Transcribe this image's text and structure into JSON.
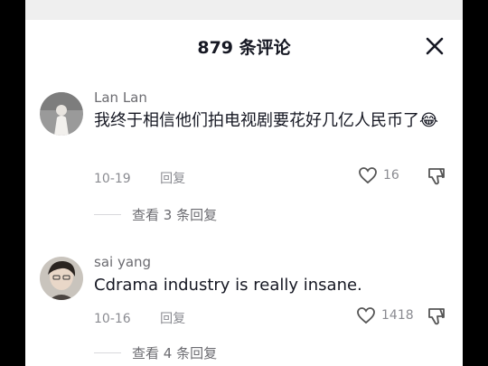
{
  "header": {
    "count": "879",
    "title_suffix": "条评论"
  },
  "comments": [
    {
      "username": "Lan Lan",
      "text": "我终于相信他们拍电视剧要花好几亿人民币了",
      "emoji": "😂",
      "date": "10-19",
      "reply_label": "回复",
      "likes": "16",
      "view_replies": "查看 3 条回复"
    },
    {
      "username": "sai yang",
      "text": "Cdrama industry is really insane.",
      "date": "10-16",
      "reply_label": "回复",
      "likes": "1418",
      "view_replies": "查看 4 条回复"
    }
  ],
  "icons": [
    "close-icon",
    "heart-icon",
    "dislike-icon"
  ]
}
